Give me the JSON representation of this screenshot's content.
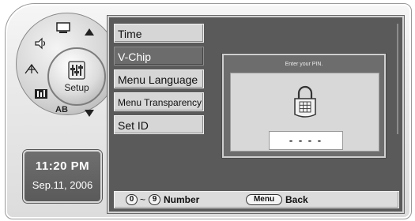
{
  "clock": {
    "time": "11:20 PM",
    "date": "Sep.11, 2006"
  },
  "wheel": {
    "hub_label": "Setup",
    "segments": [
      {
        "icon": "tv-screen-icon",
        "label": ""
      },
      {
        "icon": "speaker-icon",
        "label": ""
      },
      {
        "icon": "antenna-icon",
        "label": ""
      },
      {
        "icon": "equalizer-icon",
        "label": ""
      },
      {
        "icon": "ab-icon",
        "label": "AB"
      }
    ]
  },
  "menu": {
    "items": [
      {
        "label": "Time",
        "active": false
      },
      {
        "label": "V-Chip",
        "active": true
      },
      {
        "label": "Menu Language",
        "active": false
      },
      {
        "label": "Menu Transparency",
        "active": false
      },
      {
        "label": "Set ID",
        "active": false
      }
    ]
  },
  "pin_dialog": {
    "title": "Enter your PIN.",
    "entry": "- - - -",
    "icon": "lock-icon"
  },
  "footer": {
    "key_from": "0",
    "separator": "~",
    "key_to": "9",
    "number_label": "Number",
    "menu_key": "Menu",
    "back_label": "Back"
  },
  "colors": {
    "screen_bg": "#5a5a5a",
    "menu_item_bg": "#d6d6d6",
    "active_item_bg": "#6c6c6c",
    "dialog_bg": "#6d6d6d"
  }
}
